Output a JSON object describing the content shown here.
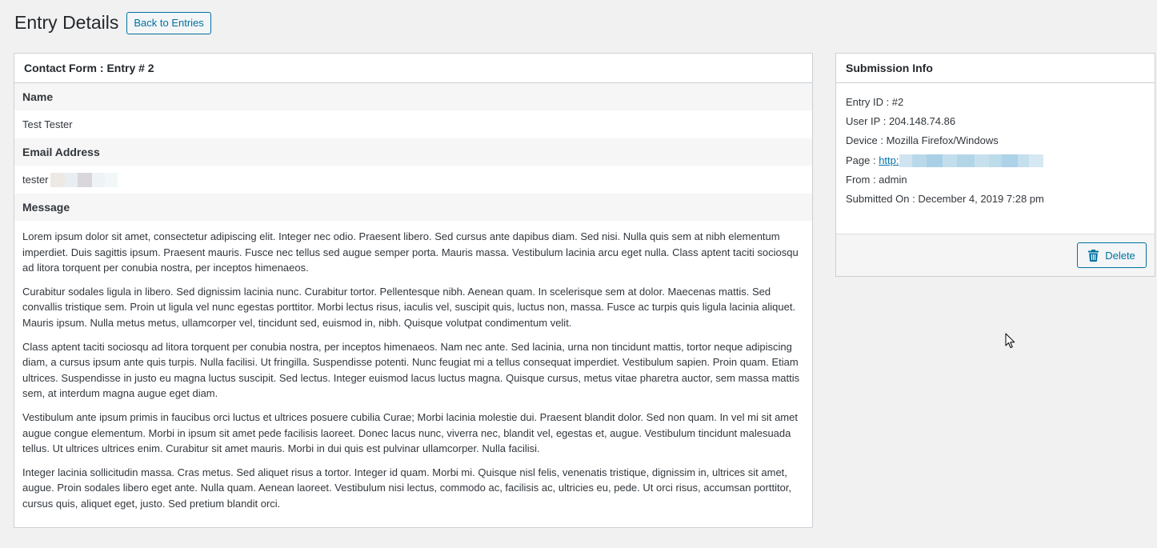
{
  "page": {
    "title": "Entry Details",
    "back_button": "Back to Entries"
  },
  "entry": {
    "card_title": "Contact Form : Entry # 2",
    "fields": [
      {
        "label": "Name",
        "value": "Test Tester"
      },
      {
        "label": "Email Address",
        "value": "tester"
      },
      {
        "label": "Message"
      }
    ],
    "message_paragraphs": [
      "Lorem ipsum dolor sit amet, consectetur adipiscing elit. Integer nec odio. Praesent libero. Sed cursus ante dapibus diam. Sed nisi. Nulla quis sem at nibh elementum imperdiet. Duis sagittis ipsum. Praesent mauris. Fusce nec tellus sed augue semper porta. Mauris massa. Vestibulum lacinia arcu eget nulla. Class aptent taciti sociosqu ad litora torquent per conubia nostra, per inceptos himenaeos.",
      "Curabitur sodales ligula in libero. Sed dignissim lacinia nunc. Curabitur tortor. Pellentesque nibh. Aenean quam. In scelerisque sem at dolor. Maecenas mattis. Sed convallis tristique sem. Proin ut ligula vel nunc egestas porttitor. Morbi lectus risus, iaculis vel, suscipit quis, luctus non, massa. Fusce ac turpis quis ligula lacinia aliquet. Mauris ipsum. Nulla metus metus, ullamcorper vel, tincidunt sed, euismod in, nibh. Quisque volutpat condimentum velit.",
      "Class aptent taciti sociosqu ad litora torquent per conubia nostra, per inceptos himenaeos. Nam nec ante. Sed lacinia, urna non tincidunt mattis, tortor neque adipiscing diam, a cursus ipsum ante quis turpis. Nulla facilisi. Ut fringilla. Suspendisse potenti. Nunc feugiat mi a tellus consequat imperdiet. Vestibulum sapien. Proin quam. Etiam ultrices. Suspendisse in justo eu magna luctus suscipit. Sed lectus. Integer euismod lacus luctus magna. Quisque cursus, metus vitae pharetra auctor, sem massa mattis sem, at interdum magna augue eget diam.",
      "Vestibulum ante ipsum primis in faucibus orci luctus et ultrices posuere cubilia Curae; Morbi lacinia molestie dui. Praesent blandit dolor. Sed non quam. In vel mi sit amet augue congue elementum. Morbi in ipsum sit amet pede facilisis laoreet. Donec lacus nunc, viverra nec, blandit vel, egestas et, augue. Vestibulum tincidunt malesuada tellus. Ut ultrices ultrices enim. Curabitur sit amet mauris. Morbi in dui quis est pulvinar ullamcorper. Nulla facilisi.",
      "Integer lacinia sollicitudin massa. Cras metus. Sed aliquet risus a tortor. Integer id quam. Morbi mi. Quisque nisl felis, venenatis tristique, dignissim in, ultrices sit amet, augue. Proin sodales libero eget ante. Nulla quam. Aenean laoreet. Vestibulum nisi lectus, commodo ac, facilisis ac, ultricies eu, pede. Ut orci risus, accumsan porttitor, cursus quis, aliquet eget, justo. Sed pretium blandit orci."
    ]
  },
  "submission": {
    "title": "Submission Info",
    "entry_id": "Entry ID : #2",
    "user_ip": "User IP : 204.148.74.86",
    "device": "Device : Mozilla Firefox/Windows",
    "page_label": "Page : ",
    "page_link": "http:",
    "from": "From : admin",
    "submitted_on": "Submitted On : December 4, 2019 7:28 pm",
    "delete_button": "Delete"
  },
  "icons": {
    "delete": "trash-icon",
    "cursor": "mouse-pointer-icon"
  },
  "colors": {
    "accent": "#0071a1",
    "link": "#0073aa",
    "background": "#f1f1f1"
  }
}
